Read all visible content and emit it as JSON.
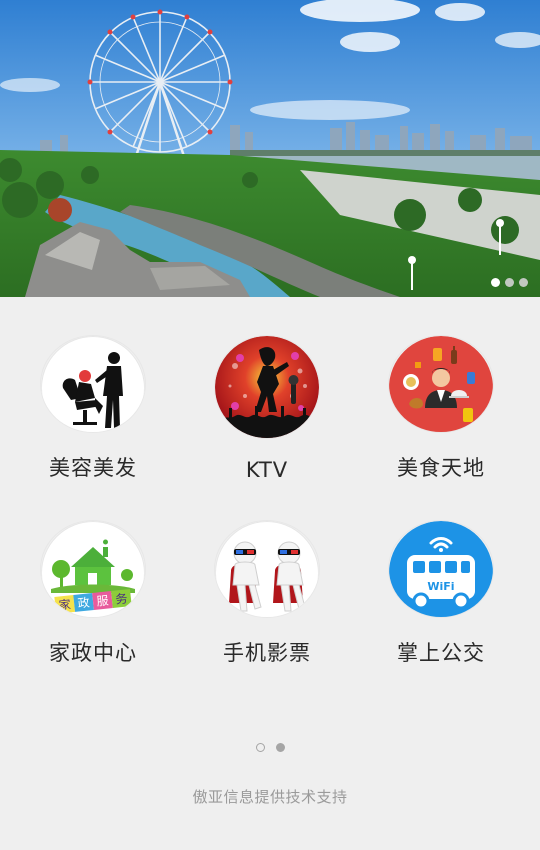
{
  "banner": {
    "image": "city-park-ferris-wheel-photo",
    "slide_count": 3,
    "active_slide": 1
  },
  "services": [
    {
      "label": "美容美发",
      "icon": "salon-icon",
      "color": "#ffffff"
    },
    {
      "label": "KTV",
      "icon": "ktv-singer-icon",
      "color": "#c0141c"
    },
    {
      "label": "美食天地",
      "icon": "food-waiter-icon",
      "color": "#e0453e"
    },
    {
      "label": "家政中心",
      "icon": "housekeeping-house-icon",
      "color": "#ffffff"
    },
    {
      "label": "手机影票",
      "icon": "movie-3d-glasses-icon",
      "color": "#ffffff"
    },
    {
      "label": "掌上公交",
      "icon": "wifi-bus-icon",
      "color": "#1d93e6"
    }
  ],
  "housekeeping_sign": [
    "家",
    "政",
    "服",
    "务"
  ],
  "bus_sign": "WiFi",
  "pager": {
    "pages": 2,
    "active_page": 2
  },
  "footer": {
    "text": "傲亚信息提供技术支持"
  }
}
